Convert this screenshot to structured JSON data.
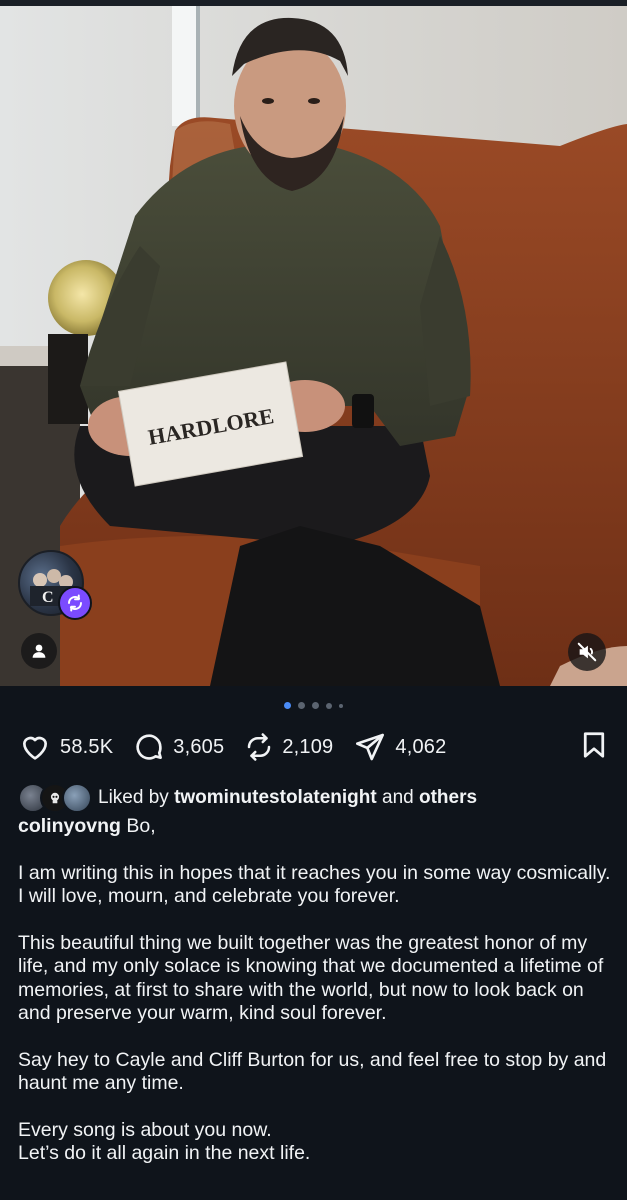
{
  "post": {
    "slides_count": 5,
    "active_slide": 1,
    "media_alt": "Man in a dark green sweater seated on an orange couch holding a card",
    "card_text": "HARDLORE"
  },
  "counts": {
    "likes": "58.5K",
    "comments": "3,605",
    "reposts": "2,109",
    "shares": "4,062"
  },
  "liked_by": {
    "prefix": "Liked by",
    "user": "twominutestolatenight",
    "conjunction": "and",
    "others": "others"
  },
  "caption": {
    "username": "colinyovng",
    "first_line": "Bo,",
    "paragraphs": [
      "I am writing this in hopes that it reaches you in some way cosmically. I will love, mourn, and celebrate you forever.",
      "This beautiful thing we built together was the greatest honor of my life, and my only solace is knowing that we documented a lifetime of memories, at first to share with the world, but now to look back on and preserve your warm, kind soul forever.",
      "Say hey to Cayle and Cliff Burton for us, and feel free to stop by and haunt me any time.",
      "Every song is about you now.\nLet’s do it all again in the next life."
    ]
  },
  "icons": {
    "like": "heart-icon",
    "comment": "comment-bubble-icon",
    "repost": "repost-icon",
    "share": "paper-plane-icon",
    "save": "bookmark-icon",
    "user": "user-icon",
    "mute": "speaker-muted-icon"
  },
  "colors": {
    "background": "#0f141b",
    "text": "#f1f3f5",
    "accent_dot": "#4a8cf7",
    "repost_badge": "#7b4bff"
  }
}
